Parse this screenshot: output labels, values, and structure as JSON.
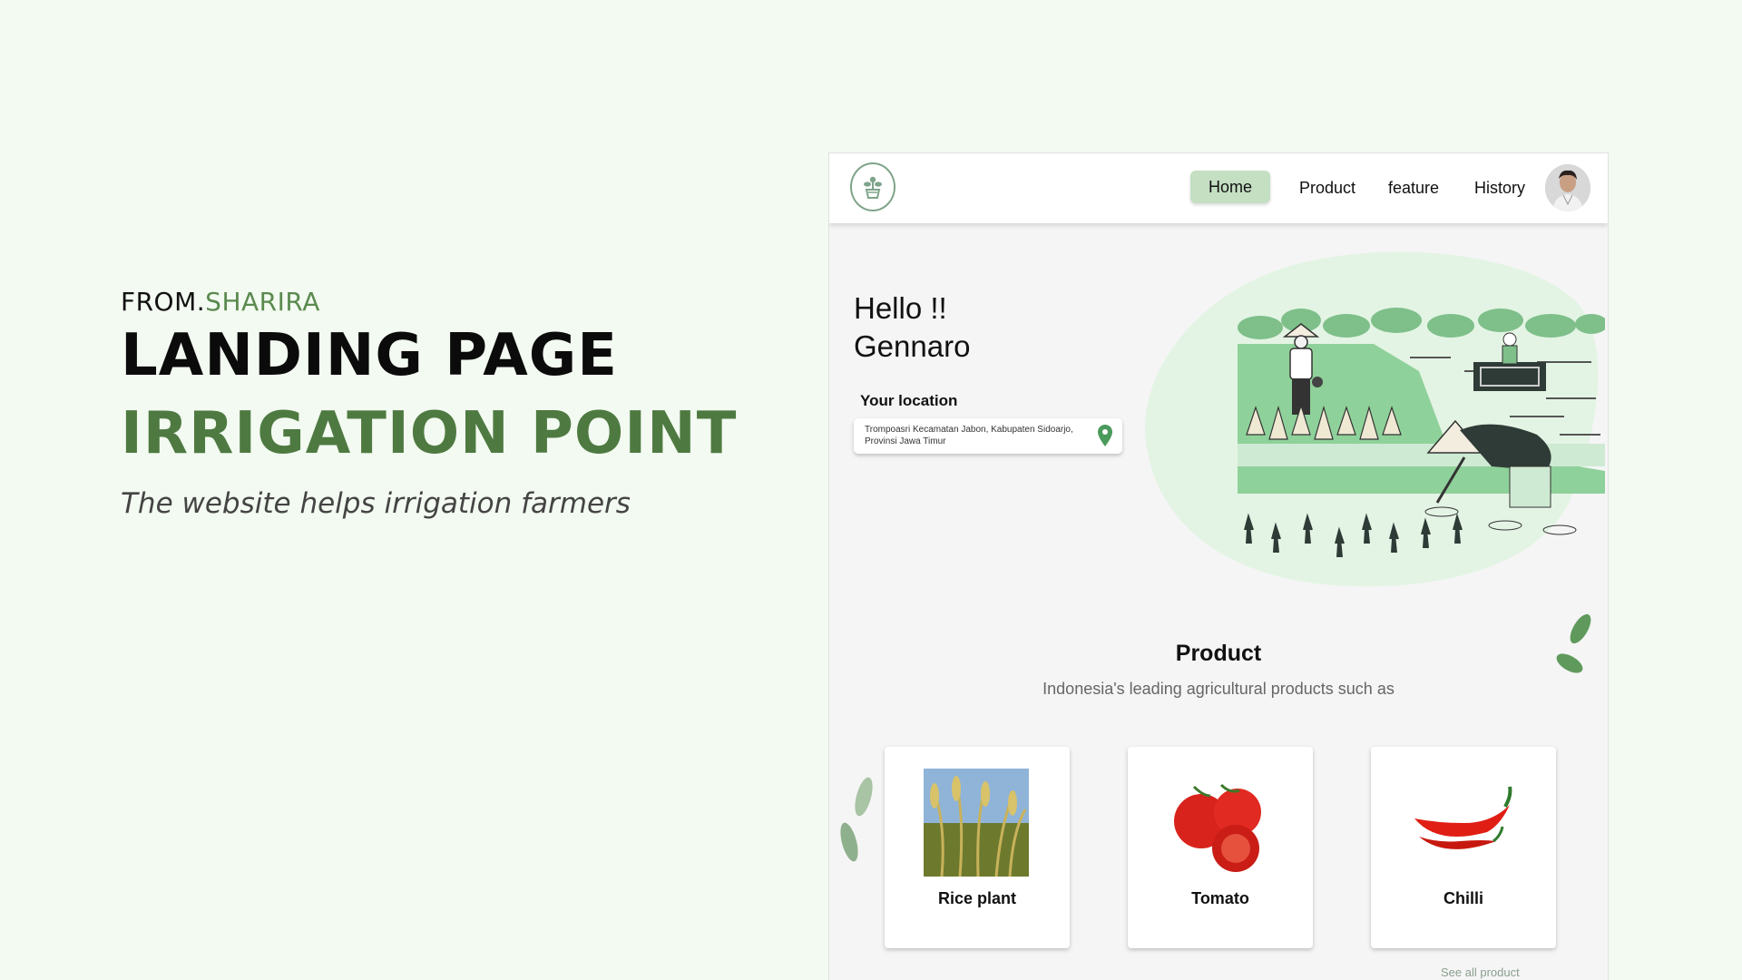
{
  "presentation": {
    "from_prefix": "FROM.",
    "from_brand": "SHARIRA",
    "title_line1": "LANDING PAGE",
    "title_line2": "IRRIGATION POINT",
    "tagline": "The website helps irrigation farmers"
  },
  "nav": {
    "items": [
      {
        "label": "Home",
        "active": true
      },
      {
        "label": "Product",
        "active": false
      },
      {
        "label": "feature",
        "active": false
      },
      {
        "label": "History",
        "active": false
      }
    ]
  },
  "hero": {
    "greeting": "Hello !!",
    "user_name": "Gennaro",
    "location_label": "Your location",
    "location_value": "Trompoasri Kecamatan Jabon, Kabupaten Sidoarjo, Provinsi Jawa Timur"
  },
  "products": {
    "title": "Product",
    "subtitle": "Indonesia's leading agricultural products such as",
    "items": [
      {
        "name": "Rice plant"
      },
      {
        "name": "Tomato"
      },
      {
        "name": "Chilli"
      }
    ],
    "see_all": "See all product"
  },
  "colors": {
    "page_bg": "#f3faf1",
    "brand_green": "#4e7a41",
    "nav_active": "#c4dfc2",
    "illustration_green": "#8fd19a"
  },
  "icons": [
    "plant-logo-icon",
    "location-pin-icon",
    "user-avatar"
  ]
}
